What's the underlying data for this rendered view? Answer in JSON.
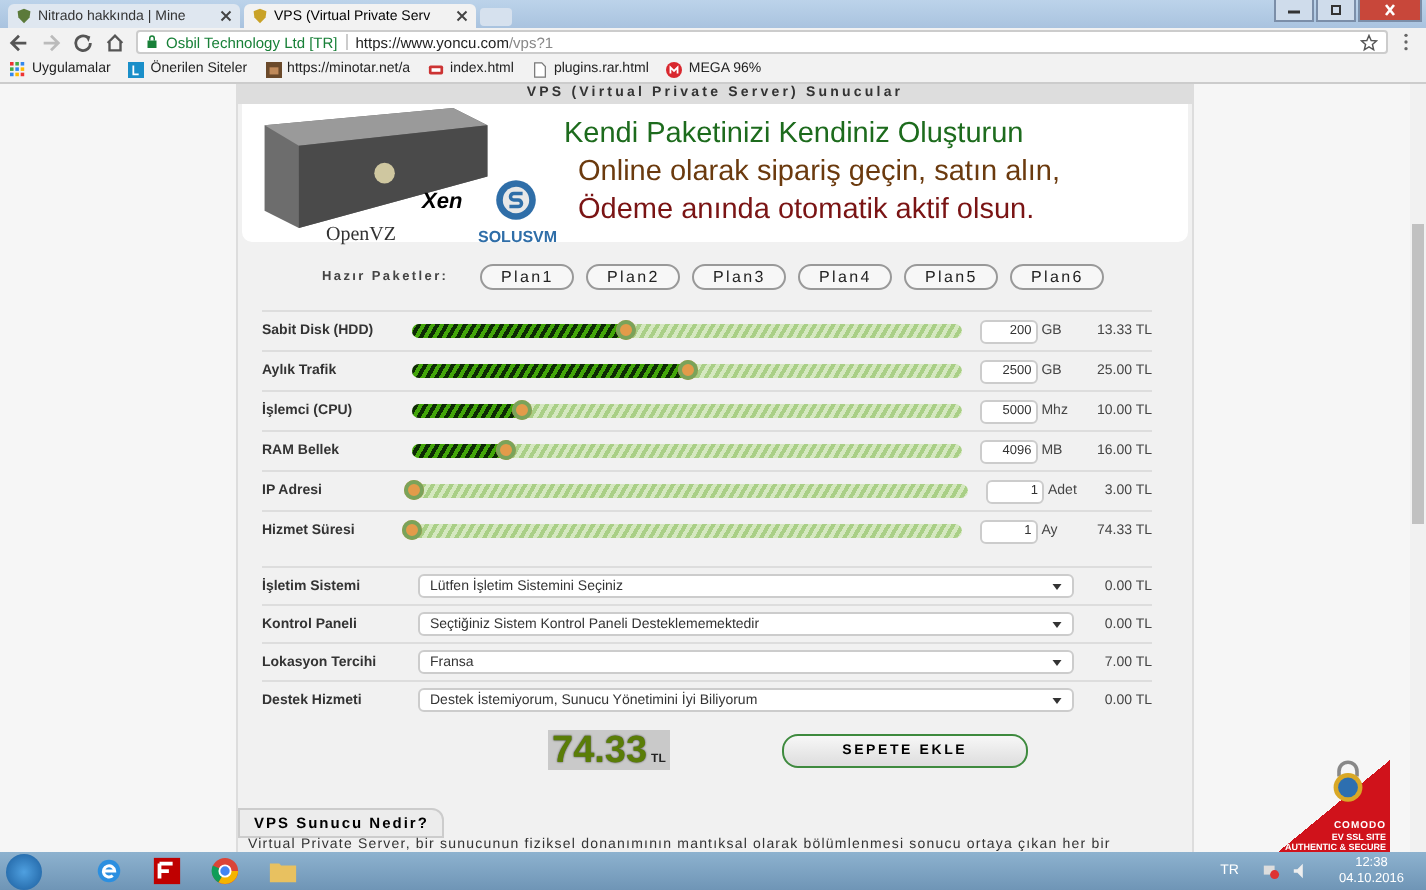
{
  "browser": {
    "tabs": [
      {
        "title": "Nitrado hakkında | Mine",
        "selected": false
      },
      {
        "title": "VPS (Virtual Private Serv",
        "selected": true
      }
    ],
    "address": {
      "site_identity": "Osbil Technology Ltd [TR]",
      "url_host": "https://www.yoncu.com",
      "url_path": "/vps?1"
    },
    "bookmarks": [
      "Uygulamalar",
      "Önerilen Siteler",
      "https://minotar.net/a",
      "index.html",
      "plugins.rar.html",
      "MEGA 96%"
    ]
  },
  "page": {
    "section_title": "VPS (Virtual Private Server) Sunucular",
    "banner": {
      "logos": [
        "Xen",
        "OpenVZ",
        "SOLUSVM"
      ],
      "lines": [
        {
          "text": "Kendi Paketinizi Kendiniz Oluşturun",
          "color": "#1d6b1d"
        },
        {
          "text": "Online olarak sipariş geçin, satın alın,",
          "color": "#6b3a0e"
        },
        {
          "text": "Ödeme anında otomatik aktif olsun.",
          "color": "#7a1414"
        }
      ]
    },
    "plans_label": "Hazır Paketler:",
    "plans": [
      "Plan1",
      "Plan2",
      "Plan3",
      "Plan4",
      "Plan5",
      "Plan6"
    ],
    "sliders": [
      {
        "label": "Sabit Disk (HDD)",
        "level": 0.39,
        "value": "200",
        "unit": "GB",
        "price": "13.33 TL"
      },
      {
        "label": "Aylık Trafik",
        "level": 0.5,
        "value": "2500",
        "unit": "GB",
        "price": "25.00 TL"
      },
      {
        "label": "İşlemci (CPU)",
        "level": 0.2,
        "value": "5000",
        "unit": "Mhz",
        "price": "10.00 TL"
      },
      {
        "label": "RAM Bellek",
        "level": 0.17,
        "value": "4096",
        "unit": "MB",
        "price": "16.00 TL"
      },
      {
        "label": "IP Adresi",
        "level": 0,
        "value": "1",
        "unit": "Adet",
        "price": "3.00 TL"
      },
      {
        "label": "Hizmet Süresi",
        "level": 0,
        "value": "1",
        "unit": "Ay",
        "price": "74.33 TL"
      }
    ],
    "selects": [
      {
        "label": "İşletim Sistemi",
        "value": "Lütfen İşletim Sistemini Seçiniz",
        "price": "0.00 TL"
      },
      {
        "label": "Kontrol Paneli",
        "value": "Seçtiğiniz Sistem Kontrol Paneli Desteklememektedir",
        "price": "0.00 TL"
      },
      {
        "label": "Lokasyon Tercihi",
        "value": "Fransa",
        "price": "7.00 TL"
      },
      {
        "label": "Destek Hizmeti",
        "value": "Destek İstemiyorum, Sunucu Yönetimini İyi Biliyorum",
        "price": "0.00 TL"
      }
    ],
    "total": "74.33",
    "currency": "TL",
    "cart_button": "SEPETE EKLE",
    "info_tab": "VPS Sunucu Nedir?",
    "info_text": "Virtual Private Server, bir sunucunun fiziksel donanımının mantıksal olarak bölümlenmesi sonucu ortaya çıkan her bir",
    "seal": [
      "COMODO",
      "EV SSL SITE",
      "AUTHENTIC & SECURE"
    ]
  },
  "taskbar": {
    "language": "TR",
    "time": "12:38",
    "date": "04.10.2016"
  }
}
